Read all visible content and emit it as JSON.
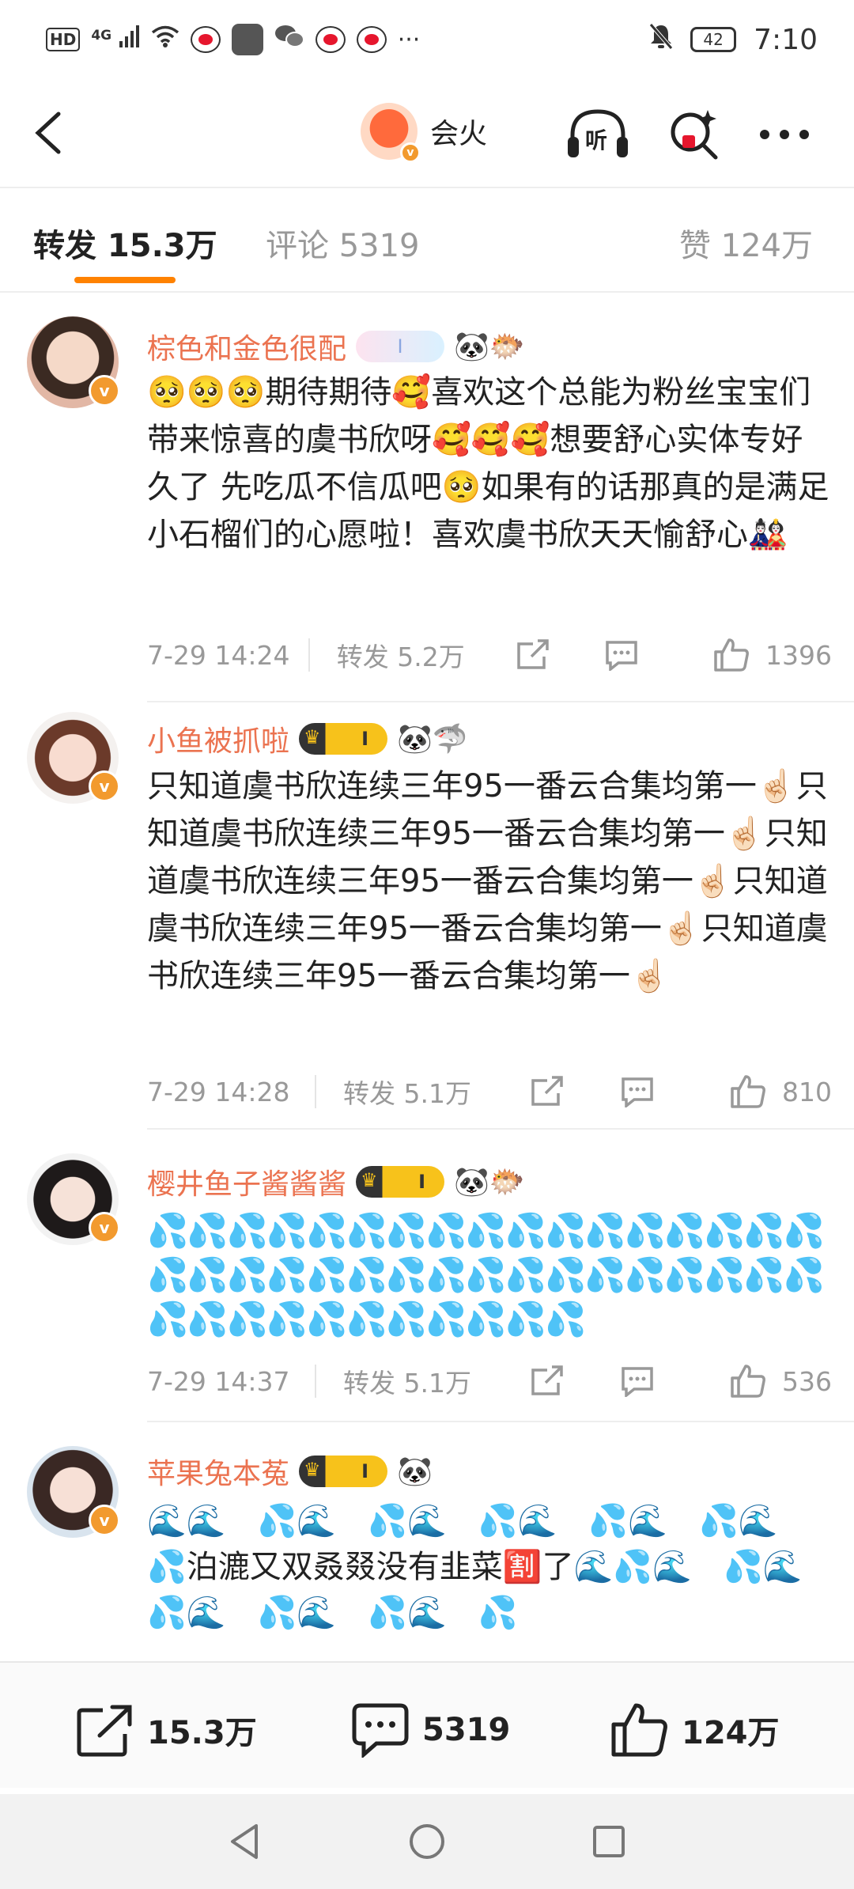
{
  "status_bar": {
    "hd_label": "HD",
    "network_label": "4G",
    "battery_level": "42",
    "time": "7:10"
  },
  "header": {
    "account_name": "会火",
    "listen_label": "听"
  },
  "tabs": [
    {
      "label": "转发 15.3万",
      "active": true
    },
    {
      "label": "评论 5319",
      "active": false
    },
    {
      "label": "赞 124万",
      "active": false
    }
  ],
  "reposts": [
    {
      "name": "棕色和金色很配",
      "badge": "I",
      "badge_emojis": "🐼🐡",
      "text": "🥺🥺🥺期待期待🥰喜欢这个总能为粉丝宝宝们带来惊喜的虞书欣呀🥰🥰🥰想要舒心实体专好久了 先吃瓜不信瓜吧🥺如果有的话那真的是满足小石榴们的心愿啦！喜欢虞书欣天天愉舒心🎎",
      "time": "7-29 14:24",
      "repost_label": "转发 5.2万",
      "likes": "1396"
    },
    {
      "name": "小鱼被抓啦",
      "badge": "I",
      "badge_emojis": "🐼🦈",
      "text": "只知道虞书欣连续三年95一番云合集均第一☝🏻只知道虞书欣连续三年95一番云合集均第一☝🏻只知道虞书欣连续三年95一番云合集均第一☝🏻只知道虞书欣连续三年95一番云合集均第一☝🏻只知道虞书欣连续三年95一番云合集均第一☝🏻",
      "time": "7-29 14:28",
      "repost_label": "转发 5.1万",
      "likes": "810"
    },
    {
      "name": "樱井鱼子酱酱酱",
      "badge": "I",
      "badge_emojis": "🐼🐡",
      "text": "💦💦💦💦💦💦💦💦💦💦💦💦💦💦💦💦💦💦💦💦💦💦💦💦💦💦💦💦💦💦💦💦💦💦💦💦💦💦💦💦💦💦💦💦💦",
      "time": "7-29 14:37",
      "repost_label": "转发 5.1万",
      "likes": "536"
    },
    {
      "name": "苹果兔本菟",
      "badge": "I",
      "badge_emojis": "🐼",
      "text": "🌊🌊　💦🌊　💦🌊　💦🌊　💦🌊　💦🌊　　💦泊漉又双叒叕没有韭菜🈹了🌊💦🌊　💦🌊　💦🌊　💦🌊　💦🌊　💦"
    }
  ],
  "bottom_bar": {
    "repost_count": "15.3万",
    "comment_count": "5319",
    "like_count": "124万"
  },
  "colors": {
    "accent": "#ff8200",
    "username": "#eb7350",
    "verified": "#f29a2e"
  }
}
